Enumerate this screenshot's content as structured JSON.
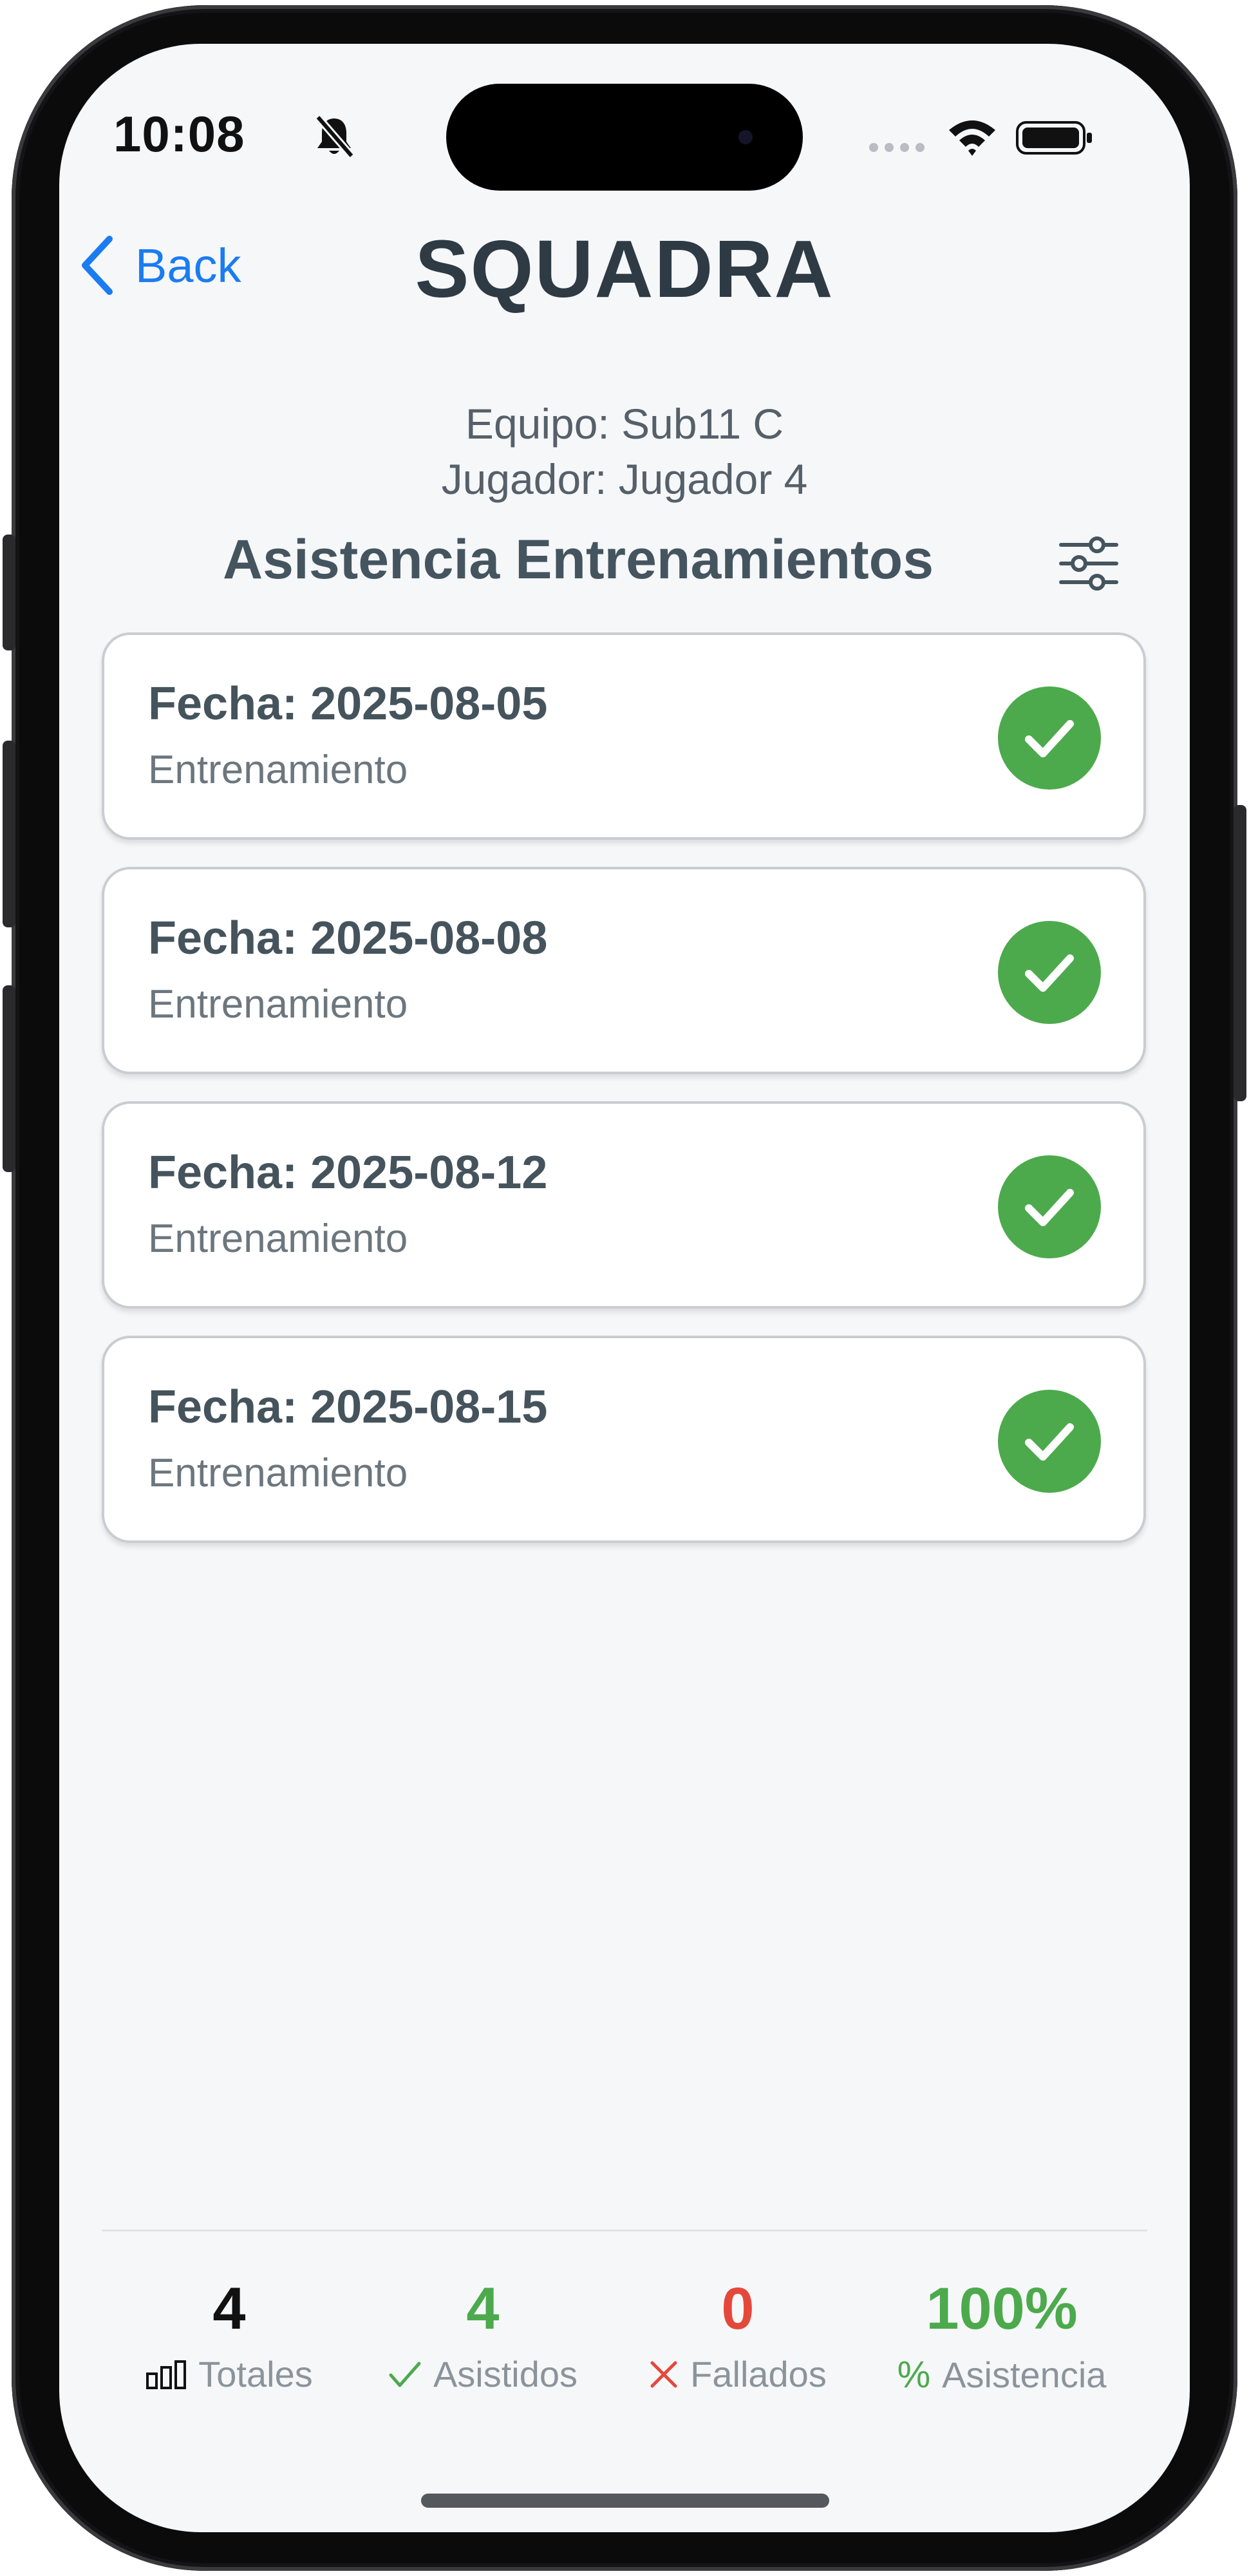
{
  "status_bar": {
    "time": "10:08",
    "icons": [
      "bell-slash-icon",
      "cellular-dots-icon",
      "wifi-icon",
      "battery-icon"
    ]
  },
  "nav": {
    "back_label": "Back",
    "title": "SQUADRA"
  },
  "info": {
    "team": "Equipo: Sub11 C",
    "player": "Jugador: Jugador 4"
  },
  "section": {
    "title": "Asistencia Entrenamientos",
    "filter_icon": "sliders-icon"
  },
  "sessions": [
    {
      "date": "Fecha: 2025-08-05",
      "type": "Entrenamiento",
      "status_icon": "check-icon"
    },
    {
      "date": "Fecha: 2025-08-08",
      "type": "Entrenamiento",
      "status_icon": "check-icon"
    },
    {
      "date": "Fecha: 2025-08-12",
      "type": "Entrenamiento",
      "status_icon": "check-icon"
    },
    {
      "date": "Fecha: 2025-08-15",
      "type": "Entrenamiento",
      "status_icon": "check-icon"
    }
  ],
  "stats": [
    {
      "value": "4",
      "label": "Totales",
      "icon": "bar-chart-icon",
      "color": "#111111"
    },
    {
      "value": "4",
      "label": "Asistidos",
      "icon": "check-icon",
      "color": "#4caa4c"
    },
    {
      "value": "0",
      "label": "Fallados",
      "icon": "x-icon",
      "color": "#e5483b"
    },
    {
      "value": "100%",
      "label": "Asistencia",
      "icon": "percent-icon",
      "color": "#4caa4c"
    }
  ],
  "colors": {
    "accent": "#1a7cf1",
    "success": "#4caa4c",
    "danger": "#e5483b",
    "background": "#f6f7f9"
  }
}
